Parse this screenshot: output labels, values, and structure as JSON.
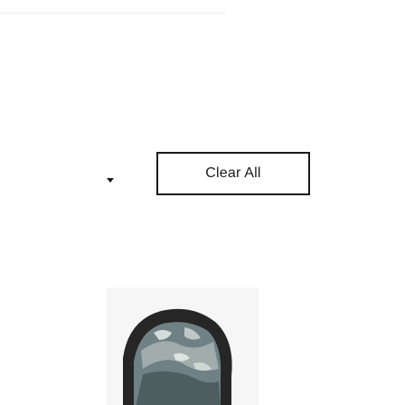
{
  "filters": {
    "clear_all_label": "Clear All",
    "dropdown_icon": "caret-down-icon"
  },
  "product": {
    "image_description_icon": "product-thumbnail"
  },
  "colors": {
    "text": "#1a1a1a",
    "border": "#1a1a1a",
    "card_background": "#f6f6f6",
    "frame": "#2a2a2a",
    "mat": "#f2f2ee"
  }
}
